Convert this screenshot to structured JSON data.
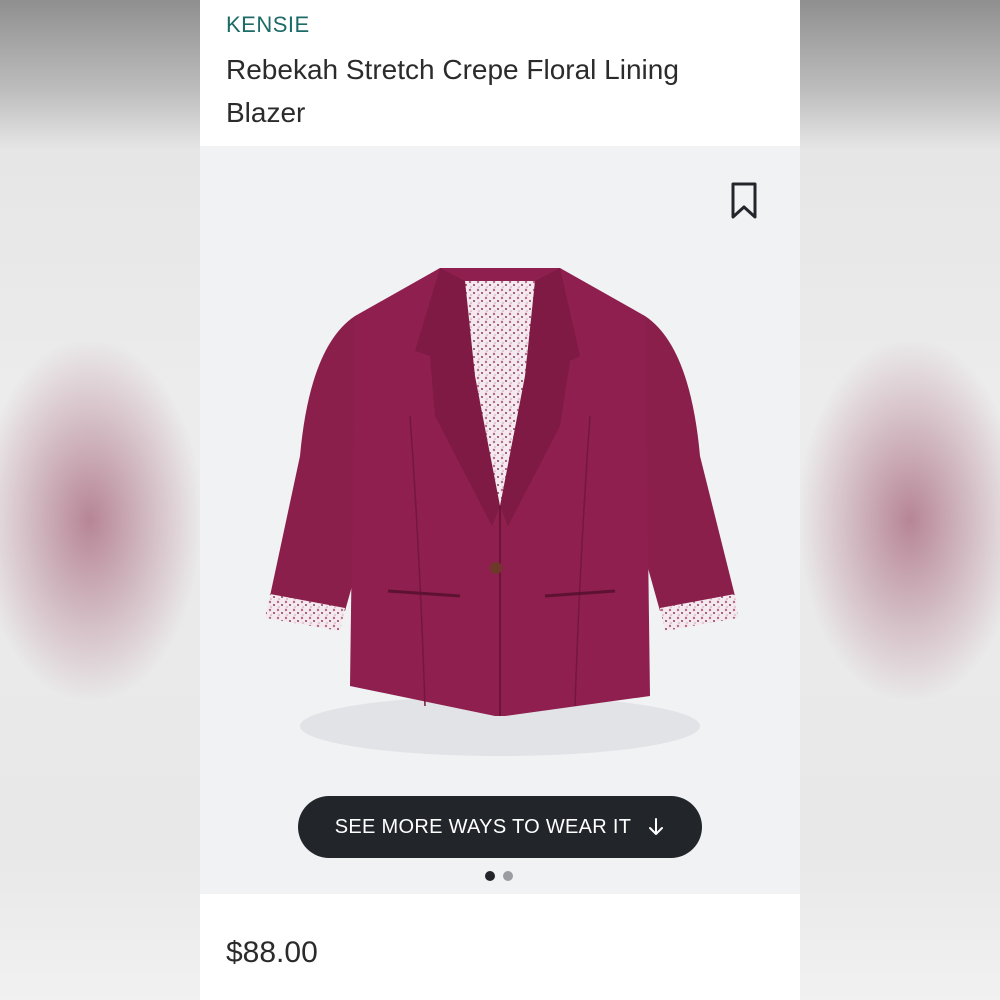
{
  "product": {
    "brand": "KENSIE",
    "title": "Rebekah Stretch Crepe Floral Lining Blazer",
    "price": "$88.00",
    "image_subject": "blazer",
    "garment_color": "#8e1f4f"
  },
  "cta": {
    "label": "SEE MORE WAYS TO WEAR IT",
    "icon": "arrow-down-icon"
  },
  "carousel": {
    "total": 2,
    "active_index": 0
  },
  "icons": {
    "save": "bookmark-icon"
  },
  "colors": {
    "brand": "#1c6b66",
    "cta_background": "#22262b",
    "image_background": "#f1f2f4"
  }
}
